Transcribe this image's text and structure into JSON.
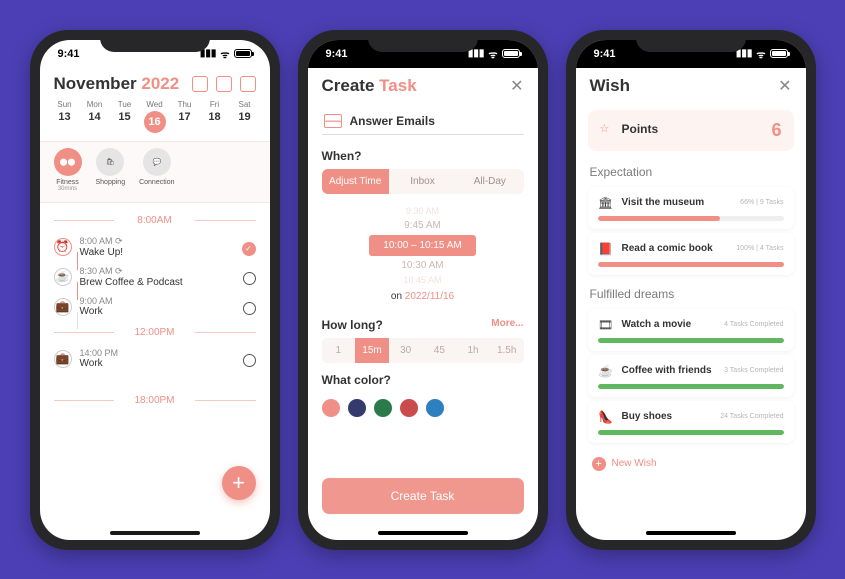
{
  "status": {
    "time": "9:41",
    "battery": "99"
  },
  "screen1": {
    "month": "November",
    "year": "2022",
    "week": [
      {
        "label": "Sun",
        "num": "13"
      },
      {
        "label": "Mon",
        "num": "14"
      },
      {
        "label": "Tue",
        "num": "15"
      },
      {
        "label": "Wed",
        "num": "16",
        "selected": true
      },
      {
        "label": "Thu",
        "num": "17"
      },
      {
        "label": "Fri",
        "num": "18"
      },
      {
        "label": "Sat",
        "num": "19"
      }
    ],
    "cats": [
      {
        "label": "Fitness",
        "sub": "30mins",
        "active": true
      },
      {
        "label": "Shopping"
      },
      {
        "label": "Connection"
      }
    ],
    "div1": "8:00AM",
    "tasks": [
      {
        "time": "8:00 AM",
        "name": "Wake Up!",
        "icon": "alarm",
        "done": true,
        "active": true
      },
      {
        "time": "8:30 AM",
        "name": "Brew Coffee & Podcast",
        "icon": "coffee"
      },
      {
        "time": "9:00 AM",
        "name": "Work",
        "icon": "briefcase"
      }
    ],
    "div2": "12:00PM",
    "tasks2": [
      {
        "time": "14:00 PM",
        "name": "Work",
        "icon": "briefcase"
      }
    ],
    "div3": "18:00PM"
  },
  "screen2": {
    "title_a": "Create",
    "title_b": "Task",
    "input": "Answer Emails",
    "when_label": "When?",
    "segs": [
      "Adjust Time",
      "Inbox",
      "All-Day"
    ],
    "seg_selected": 0,
    "picker": {
      "above2": "9:30 AM",
      "above1": "9:45 AM",
      "selected": "10:00 – 10:15 AM",
      "below1": "10:30 AM",
      "below2": "10:45 AM",
      "date_prefix": "on ",
      "date": "2022/11/16"
    },
    "howlong_label": "How long?",
    "more": "More...",
    "durations": [
      "1",
      "15m",
      "30",
      "45",
      "1h",
      "1.5h"
    ],
    "duration_selected": 1,
    "color_label": "What color?",
    "colors": [
      "#ef8f85",
      "#343a6b",
      "#2b7a4b",
      "#c94b4b",
      "#2d7fc1"
    ],
    "create_btn": "Create Task"
  },
  "screen3": {
    "title": "Wish",
    "points_label": "Points",
    "points_value": "6",
    "sec_exp": "Expectation",
    "exp": [
      {
        "title": "Visit the museum",
        "meta": "66% | 9 Tasks",
        "pct": 66
      },
      {
        "title": "Read a comic book",
        "meta": "100% | 4 Tasks",
        "pct": 100
      }
    ],
    "sec_ful": "Fulfilled dreams",
    "ful": [
      {
        "title": "Watch a movie",
        "meta": "4 Tasks Completed",
        "icon": "film"
      },
      {
        "title": "Coffee with friends",
        "meta": "3 Tasks Completed",
        "icon": "coffee"
      },
      {
        "title": "Buy shoes",
        "meta": "24 Tasks Completed",
        "icon": "shoe"
      }
    ],
    "new_wish": "New Wish"
  }
}
